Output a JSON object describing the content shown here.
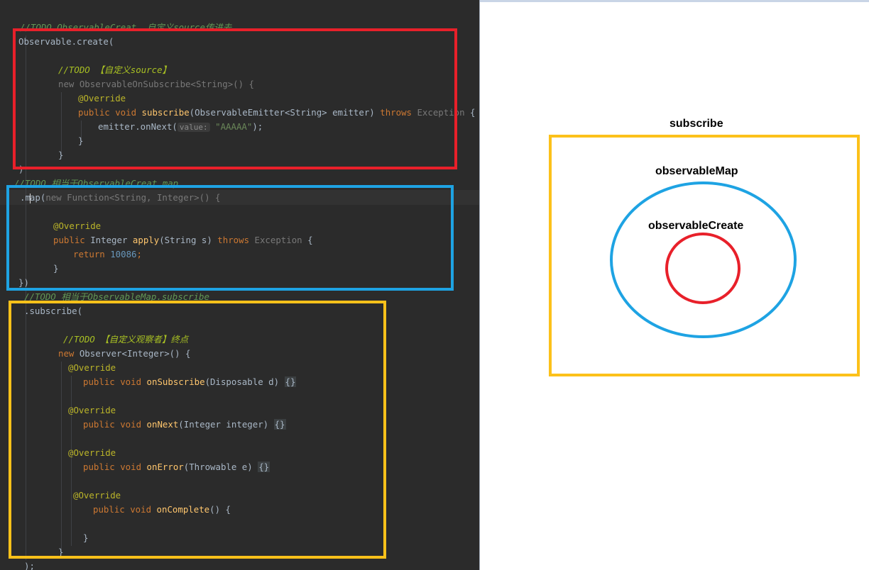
{
  "colors": {
    "editor_bg": "#2b2b2b",
    "create_highlight": "#e8202a",
    "map_highlight": "#1ea3e3",
    "subscribe_highlight": "#fcc11a"
  },
  "code": {
    "comment_create": "//TODO ObservableCreat  自定义source传进去",
    "observable_create": "Observable.create(",
    "todo_source": "//TODO 【自定义source】",
    "new_on_subscribe": "new ObservableOnSubscribe<String>() {",
    "override": "@Override",
    "subscribe_sig_kw": "public void ",
    "subscribe_name": "subscribe",
    "subscribe_params": "(ObservableEmitter<String> emitter) ",
    "throws_kw": "throws ",
    "exception_name": "Exception",
    "open_brace": " {",
    "emitter_call": "emitter.onNext(",
    "param_hint": "value:",
    "emit_value": "\"AAAAA\"",
    "emit_close": ");",
    "close_brace": "}",
    "close_paren": ")",
    "comment_map": "//TODO 相当于ObservableCreat.map",
    "map_dot": ".m",
    "map_rest": "ap(",
    "map_new": "new Function<String, Integer>() {",
    "apply_kw": "public ",
    "apply_type": "Integer ",
    "apply_name": "apply",
    "apply_params": "(String s) ",
    "return_kw": "return ",
    "return_value": "10086",
    "semicolon": ";",
    "close_map": "})",
    "comment_subscribe": "//TODO 相当于ObservableMap.subscribe",
    "subscribe_call": ".subscribe(",
    "todo_observer": "//TODO 【自定义观察者】终点",
    "new_kw": "new ",
    "observer_type": "Observer<Integer>() {",
    "on_subscribe_name": "onSubscribe",
    "on_subscribe_params": "(Disposable d) ",
    "on_next_name": "onNext",
    "on_next_params": "(Integer integer) ",
    "on_error_name": "onError",
    "on_error_params": "(Throwable e) ",
    "on_complete_name": "onComplete",
    "on_complete_params": "() {",
    "folded_body": "{}",
    "final_close": ");"
  },
  "diagram": {
    "outer_label": "subscribe",
    "middle_label": "observableMap",
    "inner_label": "observableCreate"
  }
}
